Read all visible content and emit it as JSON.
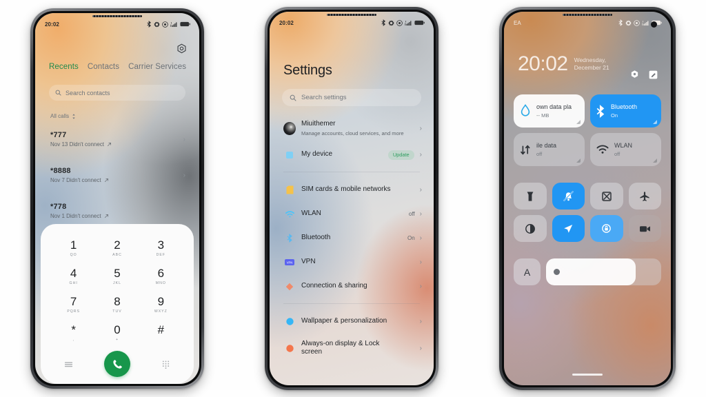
{
  "meta": {
    "background_color": "#ffffff"
  },
  "phone1": {
    "name": "dialer-phone",
    "statusbar": {
      "time": "20:02",
      "icons": [
        "bluetooth-icon",
        "nfc-icon",
        "dnd-icon",
        "signal-icon",
        "battery-icon"
      ]
    },
    "header": {
      "settings_icon": "gear-icon"
    },
    "tabs": [
      {
        "label": "Recents",
        "active": true
      },
      {
        "label": "Contacts",
        "active": false
      },
      {
        "label": "Carrier Services",
        "active": false
      }
    ],
    "search": {
      "placeholder": "Search contacts",
      "icon": "search-icon"
    },
    "filter": {
      "label": "All calls",
      "icon": "sort-icon"
    },
    "calls": [
      {
        "number": "*777",
        "detail": "Nov 13 Didn't connect",
        "arrow": "outgoing-arrow-icon"
      },
      {
        "number": "*8888",
        "detail": "Nov 7 Didn't connect",
        "arrow": "outgoing-arrow-icon"
      },
      {
        "number": "*778",
        "detail": "Nov 1 Didn't connect",
        "arrow": "outgoing-arrow-icon"
      }
    ],
    "dialpad": {
      "keys": [
        {
          "digit": "1",
          "letters": "QO"
        },
        {
          "digit": "2",
          "letters": "ABC"
        },
        {
          "digit": "3",
          "letters": "DEF"
        },
        {
          "digit": "4",
          "letters": "GHI"
        },
        {
          "digit": "5",
          "letters": "JKL"
        },
        {
          "digit": "6",
          "letters": "MNO"
        },
        {
          "digit": "7",
          "letters": "PQRS"
        },
        {
          "digit": "8",
          "letters": "TUV"
        },
        {
          "digit": "9",
          "letters": "WXYZ"
        },
        {
          "digit": "*",
          "letters": ","
        },
        {
          "digit": "0",
          "letters": "+"
        },
        {
          "digit": "#",
          "letters": ""
        }
      ],
      "menu_icon": "menu-icon",
      "call_icon": "phone-call-icon",
      "keypad_icon": "keypad-icon",
      "call_button_color": "#17964b"
    }
  },
  "phone2": {
    "name": "settings-phone",
    "statusbar": {
      "time": "20:02",
      "icons": [
        "bluetooth-icon",
        "nfc-icon",
        "dnd-icon",
        "signal-icon",
        "battery-icon"
      ]
    },
    "title": "Settings",
    "search": {
      "placeholder": "Search settings",
      "icon": "search-icon"
    },
    "account": {
      "name": "Miuithemer",
      "subtitle": "Manage accounts, cloud services, and more",
      "avatar": "account-avatar"
    },
    "items": [
      {
        "label": "My device",
        "badge": "Update",
        "icon": "device-icon",
        "color": "#7fd0f5",
        "value": ""
      },
      {
        "label": "SIM cards & mobile networks",
        "icon": "sim-icon",
        "color": "#f5c24a",
        "value": ""
      },
      {
        "label": "WLAN",
        "icon": "wifi-icon",
        "color": "#4fc3f7",
        "value": "off"
      },
      {
        "label": "Bluetooth",
        "icon": "bluetooth-icon",
        "color": "#59b9f0",
        "value": "On"
      },
      {
        "label": "VPN",
        "icon": "vpn-icon",
        "color": "#5b63ef",
        "value": ""
      },
      {
        "label": "Connection & sharing",
        "icon": "connection-icon",
        "color": "#f08a6a",
        "value": ""
      },
      {
        "label": "Wallpaper & personalization",
        "icon": "wallpaper-icon",
        "color": "#35b6f6",
        "value": ""
      },
      {
        "label": "Always-on display & Lock screen",
        "icon": "lockscreen-icon",
        "color": "#f4764c",
        "value": ""
      }
    ],
    "chevron": "chevron-right-icon",
    "badge_color": "#2f9e5f"
  },
  "phone3": {
    "name": "control-center-phone",
    "statusbar": {
      "carrier": "EA",
      "icons": [
        "bluetooth-icon",
        "nfc-icon",
        "dnd-icon",
        "signal-icon",
        "battery-icon"
      ]
    },
    "clock": {
      "time": "20:02",
      "date_line1": "Wednesday,",
      "date_line2": "December 21"
    },
    "actions": [
      "gear-icon",
      "edit-icon"
    ],
    "big_tiles": [
      {
        "title": "own data pla",
        "subtitle": "-- MB",
        "state": "white",
        "icon": "data-drop-icon"
      },
      {
        "title": "Bluetooth",
        "subtitle": "On",
        "state": "blue",
        "icon": "bluetooth-icon"
      },
      {
        "title": "ile data",
        "subtitle": "off",
        "state": "glass",
        "icon": "mobile-data-icon"
      },
      {
        "title": "WLAN",
        "subtitle": "off",
        "state": "glass",
        "icon": "wifi-icon"
      }
    ],
    "small_tiles": [
      {
        "icon": "flashlight-icon",
        "state": "off"
      },
      {
        "icon": "mute-bell-icon",
        "state": "on"
      },
      {
        "icon": "screenshot-icon",
        "state": "off"
      },
      {
        "icon": "airplane-icon",
        "state": "off"
      },
      {
        "icon": "dark-mode-icon",
        "state": "off"
      },
      {
        "icon": "location-icon",
        "state": "on"
      },
      {
        "icon": "auto-rotate-lock-icon",
        "state": "on"
      },
      {
        "icon": "screen-record-icon",
        "state": "dim"
      }
    ],
    "font_button": {
      "label": "A",
      "icon": "font-size-icon"
    },
    "brightness": {
      "icon": "brightness-knob",
      "value_percent": 78
    },
    "accent_color": "#2196f3"
  }
}
